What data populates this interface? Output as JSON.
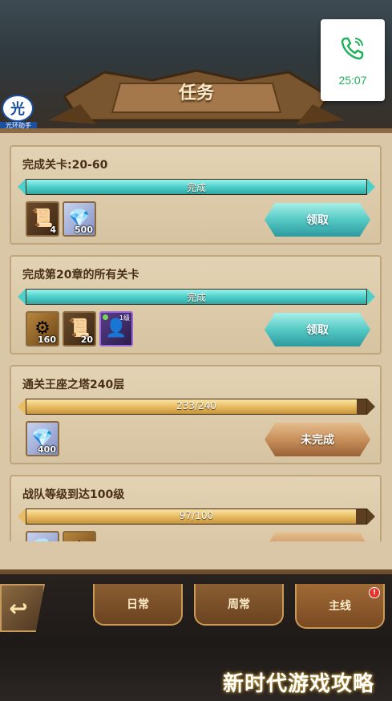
{
  "call": {
    "time": "25:07",
    "icon": "phone-icon",
    "color": "#1fb25a"
  },
  "badge": {
    "char": "光",
    "caption": "光环助手"
  },
  "header": {
    "title": "任务"
  },
  "quests": [
    {
      "title": "完成关卡:20-60",
      "progress_text": "完成",
      "progress": 1.0,
      "bar_color": "cyan",
      "rewards": [
        {
          "icon": "scroll-icon",
          "count": "4"
        },
        {
          "icon": "diamond-icon",
          "count": "500"
        }
      ],
      "button": "领取",
      "button_state": "claim"
    },
    {
      "title": "完成第20章的所有关卡",
      "progress_text": "完成",
      "progress": 1.0,
      "bar_color": "cyan",
      "rewards": [
        {
          "icon": "gear-coin-icon",
          "count": "160"
        },
        {
          "icon": "scroll-icon",
          "count": "20"
        },
        {
          "icon": "hero-portrait-icon",
          "count": "",
          "level": "1级"
        }
      ],
      "button": "领取",
      "button_state": "claim"
    },
    {
      "title": "通关王座之塔240层",
      "progress_text": "233/240",
      "progress": 0.971,
      "bar_color": "gold",
      "rewards": [
        {
          "icon": "diamond-icon",
          "count": "400"
        }
      ],
      "button": "未完成",
      "button_state": "incomplete"
    },
    {
      "title": "战队等级到达100级",
      "progress_text": "97/100",
      "progress": 0.97,
      "bar_color": "gold",
      "rewards": [
        {
          "icon": "diamond-icon",
          "count": ""
        },
        {
          "icon": "gear-coin-icon",
          "count": ""
        }
      ],
      "button": "",
      "button_state": "incomplete"
    }
  ],
  "nav": {
    "back_icon": "back-arrow-icon",
    "tabs": [
      {
        "label": "日常"
      },
      {
        "label": "周常"
      },
      {
        "label": "主线",
        "notify": "!"
      }
    ]
  },
  "watermark": "新时代游戏攻略"
}
